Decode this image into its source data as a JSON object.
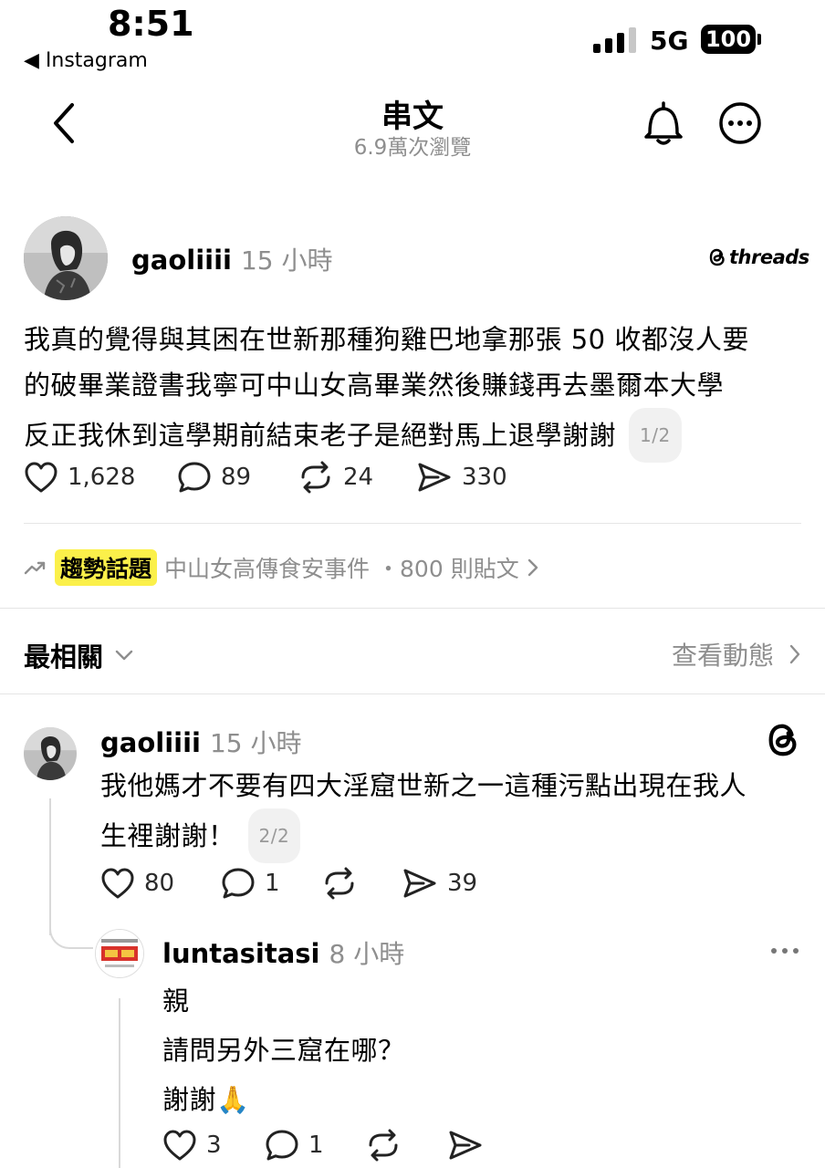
{
  "status_bar": {
    "time": "8:51",
    "back_app": "◀ Instagram",
    "network": "5G",
    "battery": "100"
  },
  "header": {
    "title": "串文",
    "views": "6.9萬次瀏覽"
  },
  "post": {
    "username": "gaoliiii",
    "time": "15 小時",
    "brand": "threads",
    "text_lines": [
      "我真的覺得與其困在世新那種狗雞巴地拿那張 50 收都沒人要",
      "的破畢業證書我寧可中山女高畢業然後賺錢再去墨爾本大學",
      "反正我休到這學期前結束老子是絕對馬上退學謝謝"
    ],
    "page_badge": "1/2",
    "likes": "1,628",
    "comments": "89",
    "reposts": "24",
    "shares": "330"
  },
  "trending": {
    "label": "趨勢話題",
    "topic": "中山女高傳食安事件",
    "count": "・800 則貼文"
  },
  "sort": {
    "label": "最相關",
    "activity": "查看動態"
  },
  "reply1": {
    "username": "gaoliiii",
    "time": "15 小時",
    "text_lines": [
      "我他媽才不要有四大淫窟世新之一這種污點出現在我人",
      "生裡謝謝！"
    ],
    "page_badge": "2/2",
    "likes": "80",
    "comments": "1",
    "shares": "39"
  },
  "reply2": {
    "username": "luntasitasi",
    "time": "8 小時",
    "text_lines": [
      "親",
      "請問另外三窟在哪？",
      "謝謝🙏"
    ],
    "likes": "3",
    "comments": "1"
  }
}
